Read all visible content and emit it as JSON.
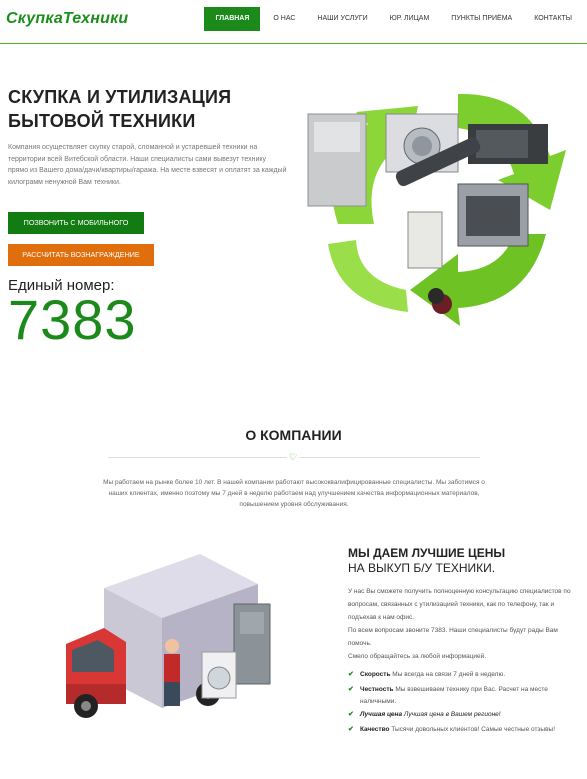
{
  "header": {
    "logo": "СкупкаТехники",
    "menu": [
      {
        "label": "ГЛАВНАЯ",
        "active": true
      },
      {
        "label": "О НАС"
      },
      {
        "label": "НАШИ УСЛУГИ"
      },
      {
        "label": "ЮР. ЛИЦАМ"
      },
      {
        "label": "ПУНКТЫ ПРИЁМА"
      },
      {
        "label": "КОНТАКТЫ"
      }
    ]
  },
  "hero": {
    "title": "СКУПКА И УТИЛИЗАЦИЯ БЫТОВОЙ ТЕХНИКИ",
    "text": "Компания осуществляет скупку старой, сломанной и устаревшей техники на территории всей Витебской области. Наши специалисты сами вывезут технику прямо из Вашего дома/дачи/квартиры/гаража. На месте взвесят и оплатят за каждый килограмм ненужной Вам техники.",
    "call_button": "ПОЗВОНИТЬ С МОБИЛЬНОГО",
    "calc_button": "РАССЧИТАТЬ ВОЗНАГРАЖДЕНИЕ",
    "hotline_label": "Единый номер:",
    "hotline_number": "7383"
  },
  "about": {
    "title": "О КОМПАНИИ",
    "divider_icon": "heart-icon",
    "text": "Мы работаем на рынке более 10 лет. В нашей компании работают высококвалифицированные специалисты. Мы заботимся о наших клиентах, именно поэтому мы 7 дней в неделю работаем над улучшением качества информационных материалов, повышением уровня обслуживания."
  },
  "prices": {
    "title": "МЫ ДАЕМ ЛУЧШИЕ ЦЕНЫ",
    "subtitle": "НА ВЫКУП Б/У ТЕХНИКИ.",
    "p1": "У нас Вы сможете получить полноценную консультацию специалистов по вопросам, связанных с утилизацией техники, как по телефону, так и подъехав к нам офис.",
    "p2": "По всем вопросам звоните 7383. Наши специалисты будут рады Вам помочь.",
    "p3": "Смело обращайтесь за любой информацией.",
    "features": [
      {
        "title": "Скорость",
        "text": "Мы всегда на связи 7 дней в неделю."
      },
      {
        "title": "Честность",
        "text": "Мы взвешиваем технику при Вас. Расчет на месте наличными."
      },
      {
        "title": "Лучшая цена",
        "text": "Лучшая цена в Вашем регионе!"
      },
      {
        "title": "Качество",
        "text": "Тысячи довольных клиентов! Самые честные отзывы!"
      }
    ]
  },
  "colors": {
    "brand_green": "#1b8a1b",
    "accent_orange": "#e06e0c",
    "recycle_green": "#7ccd2e"
  }
}
